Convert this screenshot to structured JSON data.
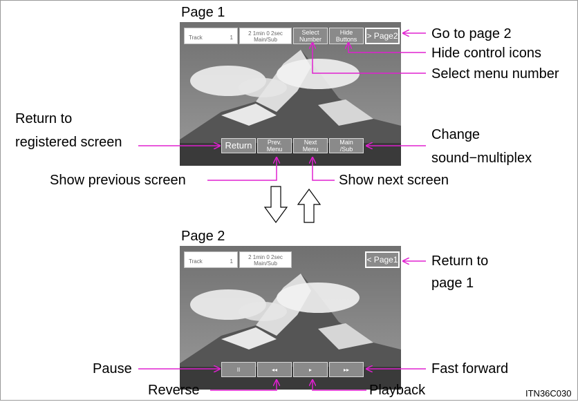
{
  "page1": {
    "title": "Page 1",
    "track_label": "Track",
    "track_value": "1",
    "time_text": "2 1min  0 2sec\nMain/Sub",
    "buttons": {
      "select_number": "Select\nNumber",
      "hide_buttons": "Hide\nButtons",
      "page2": "> Page2",
      "return": "Return",
      "prev_menu": "Prev.\nMenu",
      "next_menu": "Next\nMenu",
      "main_sub": "Main\n/Sub"
    }
  },
  "page2": {
    "title": "Page 2",
    "track_label": "Track",
    "track_value": "1",
    "time_text": "2 1min  0 2sec\nMain/Sub",
    "buttons": {
      "page1": "< Page1",
      "pause": "II",
      "reverse": "◂◂",
      "play": "▸",
      "fast_forward": "▸▸"
    }
  },
  "callouts": {
    "go_to_page2": "Go to page 2",
    "hide_control_icons": "Hide control icons",
    "select_menu_number": "Select menu number",
    "return_to_registered_1": "Return to",
    "return_to_registered_2": "registered screen",
    "change_sound_1": "Change",
    "change_sound_2": "sound−multiplex",
    "show_previous_screen": "Show previous screen",
    "show_next_screen": "Show next screen",
    "return_to_page1_1": "Return to",
    "return_to_page1_2": "page 1",
    "pause": "Pause",
    "fast_forward": "Fast forward",
    "reverse": "Reverse",
    "playback": "Playback"
  },
  "figure_code": "ITN36C030",
  "colors": {
    "callout_line": "#e020d0"
  }
}
